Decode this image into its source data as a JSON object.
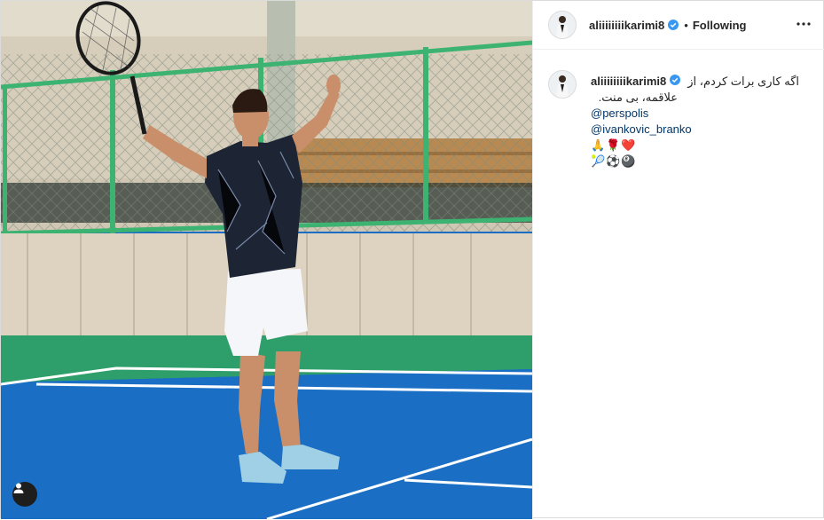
{
  "post": {
    "username": "aliiiiiiiikarimi8",
    "follow_status": "Following",
    "separator": "•",
    "caption_line1": "اگه کاری برات کردم، از",
    "caption_line2": "علاقمه، بی منت.",
    "mentions": [
      "@perspolis",
      "@ivankovic_branko"
    ],
    "emoji_line1": "🙏🌹❤️",
    "emoji_line2": "🎾⚽🎱"
  },
  "colors": {
    "verified_badge": "#3897f0",
    "mention": "#00376b",
    "court_blue": "#1a6fc4",
    "court_green": "#2e9e6a",
    "fence_green": "#3cb371"
  },
  "icons": {
    "verified": "verified-badge-icon",
    "more": "more-options-icon",
    "tag_user": "tag-user-icon"
  }
}
